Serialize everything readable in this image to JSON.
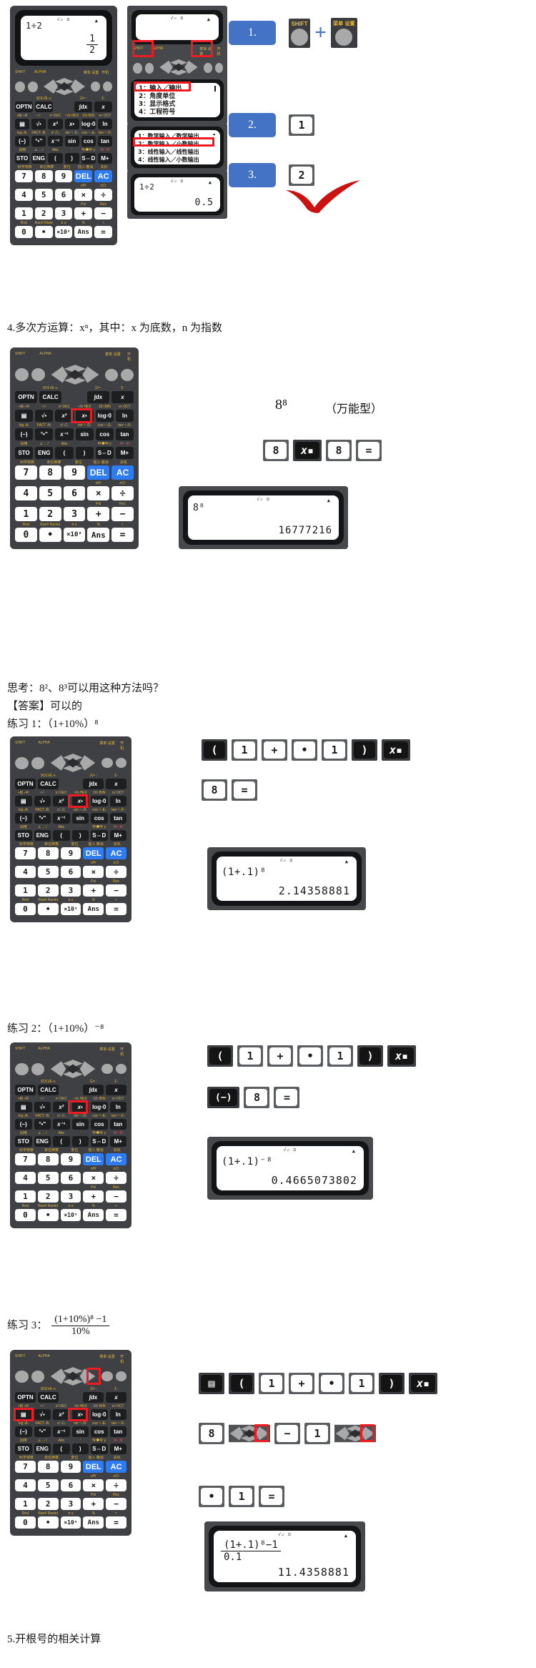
{
  "doc": {
    "section4_heading": "4.多次方运算：xⁿ，其中：x 为底数，n 为指数",
    "example_expr": "8⁸",
    "example_note": "（万能型）",
    "think_line": "思考：8²、8³可以用这种方法吗？",
    "answer_line": "【答案】可以的",
    "practice1_label": "练习 1：（1+10%）⁸",
    "practice2_label": "练习 2：（1+10%）⁻⁸",
    "practice3_label": "练习 3：",
    "practice3_num": "(1+10%)⁸ −1",
    "practice3_den": "10%",
    "section5_heading": "5.开根号的相关计算"
  },
  "calculator": {
    "brand_top_labels": [
      "SHIFT",
      "ALPHA",
      "菜单 设置",
      "开机"
    ],
    "row_labels": {
      "r1_over": [
        "SOLVE ∞",
        "",
        "☲= :",
        "Σ-"
      ],
      "r1": [
        "OPTN",
        "CALC",
        "∫dx",
        "x"
      ],
      "r2_over": [
        "▪目 ÷R",
        "ⁿ√▫",
        "x³  DEC",
        "ⁿ√b  HEX",
        "10ᵡ BIN",
        "eᵡ OCT"
      ],
      "r2": [
        "▤",
        "√▪",
        "x²",
        "x▪",
        "log▫0",
        "ln"
      ],
      "r3_over": [
        "log  ₍A₎",
        "FACT ₍B₎",
        "x!  ₍C₎",
        "sin⁻¹ ₍D₎",
        "cos⁻¹ ₍E₎",
        "tan⁻¹ ₍F₎"
      ],
      "r3": [
        "(−)",
        "°•''",
        "x⁻¹",
        "sin",
        "cos",
        "tan"
      ],
      "r4_over": [
        "调用",
        "∠ ←/",
        "Abs",
        "'",
        "x",
        "呼◆呼 y",
        "M− M"
      ],
      "r4": [
        "STO",
        "ENG",
        "(",
        ")",
        "S⇔D",
        "M+"
      ],
      "r5_over": [
        "科学常数",
        "单位换算",
        "复位",
        "插入 撤消",
        "关机"
      ],
      "r5": [
        "7",
        "8",
        "9",
        "DEL",
        "AC"
      ],
      "r6_over": [
        "nPr",
        "nCr"
      ],
      "r6": [
        "4",
        "5",
        "6",
        "×",
        "÷"
      ],
      "r7_over": [
        "Pol",
        "Rec"
      ],
      "r7": [
        "1",
        "2",
        "3",
        "+",
        "−"
      ],
      "r8_over": [
        "Rnd",
        "Ran#  Ranint",
        "π    e",
        "%",
        "≈"
      ],
      "r8": [
        "0",
        "•",
        "×10ˣ",
        "Ans",
        "="
      ]
    }
  },
  "step_panel": {
    "screen1": {
      "indicator": "√▱ ⊡",
      "expr": "",
      "result": ""
    },
    "menu1": {
      "lines": [
        "1：输入／输出",
        "2：角度单位",
        "3：显示格式",
        "4：工程符号"
      ],
      "highlight_index": 0
    },
    "menu2": {
      "lines": [
        "1：数学输入／数学输出",
        "2：数学输入／小数输出",
        "3：线性输入／线性输出",
        "4：线性输入／小数输出"
      ],
      "highlight_index": 1
    },
    "screen_result": {
      "indicator": "√▱ ⊡",
      "expr": "1÷2",
      "result": "0.5"
    },
    "steps": [
      {
        "number": "1.",
        "keys": [
          {
            "label": "SHIFT",
            "type": "round-shift"
          },
          {
            "label": "菜单 设置",
            "type": "round-setup"
          }
        ],
        "joiner": "+"
      },
      {
        "number": "2.",
        "keys": [
          {
            "label": "1",
            "type": "white"
          }
        ],
        "joiner": ""
      },
      {
        "number": "3.",
        "keys": [
          {
            "label": "2",
            "type": "white"
          }
        ],
        "joiner": ""
      }
    ]
  },
  "top_display": {
    "indicator": "√▱ ⊡",
    "expr": "1÷2",
    "result_num": "1",
    "result_den": "2"
  },
  "example": {
    "keys": [
      {
        "label": "8",
        "type": "white"
      },
      {
        "label": "x▪",
        "type": "black"
      },
      {
        "label": "8",
        "type": "white"
      },
      {
        "label": "=",
        "type": "white"
      }
    ],
    "display": {
      "indicator": "√▱ ⊡",
      "expr": "8⁸",
      "result": "16777216"
    }
  },
  "practice1": {
    "keys_row1": [
      {
        "label": "(",
        "type": "black"
      },
      {
        "label": "1",
        "type": "white"
      },
      {
        "label": "+",
        "type": "white"
      },
      {
        "label": "•",
        "type": "white"
      },
      {
        "label": "1",
        "type": "white"
      },
      {
        "label": ")",
        "type": "black"
      },
      {
        "label": "x▪",
        "type": "black"
      }
    ],
    "keys_row2": [
      {
        "label": "8",
        "type": "white"
      },
      {
        "label": "=",
        "type": "white"
      }
    ],
    "display": {
      "indicator": "√▱ ⊡",
      "expr": "(1+.1)⁸",
      "result": "2.14358881"
    }
  },
  "practice2": {
    "keys_row1": [
      {
        "label": "(",
        "type": "black"
      },
      {
        "label": "1",
        "type": "white"
      },
      {
        "label": "+",
        "type": "white"
      },
      {
        "label": "•",
        "type": "white"
      },
      {
        "label": "1",
        "type": "white"
      },
      {
        "label": ")",
        "type": "black"
      },
      {
        "label": "x▪",
        "type": "black"
      }
    ],
    "keys_row2": [
      {
        "label": "(−)",
        "type": "black"
      },
      {
        "label": "8",
        "type": "white"
      },
      {
        "label": "=",
        "type": "white"
      }
    ],
    "display": {
      "indicator": "√▱ ⊡",
      "expr": "(1+.1)⁻⁸",
      "result": "0.4665073802"
    }
  },
  "practice3": {
    "keys_row1": [
      {
        "label": "▤",
        "type": "black"
      },
      {
        "label": "(",
        "type": "black"
      },
      {
        "label": "1",
        "type": "white"
      },
      {
        "label": "+",
        "type": "white"
      },
      {
        "label": "•",
        "type": "white"
      },
      {
        "label": "1",
        "type": "white"
      },
      {
        "label": ")",
        "type": "black"
      },
      {
        "label": "x▪",
        "type": "black"
      }
    ],
    "keys_row2": [
      {
        "label": "8",
        "type": "white"
      },
      {
        "label": "dpad-right",
        "type": "dpad"
      },
      {
        "label": "−",
        "type": "white"
      },
      {
        "label": "1",
        "type": "white"
      },
      {
        "label": "dpad-right",
        "type": "dpad"
      }
    ],
    "keys_row3": [
      {
        "label": "•",
        "type": "white"
      },
      {
        "label": "1",
        "type": "white"
      },
      {
        "label": "=",
        "type": "white"
      }
    ],
    "display": {
      "indicator": "√▱ ⊡",
      "expr_num": "(1+.1)⁸−1",
      "expr_den": "0.1",
      "result": "11.4358881"
    }
  },
  "colors": {
    "accent_blue": "#4472c4",
    "highlight_red": "#ee1b22",
    "key_blue": "#2f7bf0",
    "calc_body": "#3e4044",
    "label_yellow": "#e7b93c",
    "check_red": "#cc1111"
  }
}
